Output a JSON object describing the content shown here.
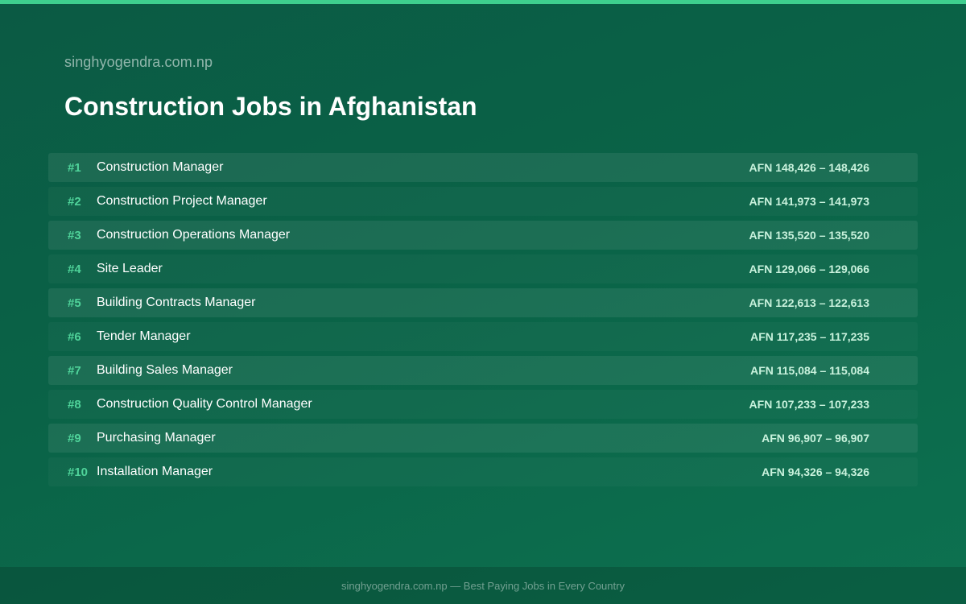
{
  "header": {
    "site_name": "singhyogendra.com.np",
    "title": "Construction Jobs in Afghanistan"
  },
  "jobs": [
    {
      "rank": "#1",
      "title": "Construction Manager",
      "salary": "AFN 148,426 – 148,426"
    },
    {
      "rank": "#2",
      "title": "Construction Project Manager",
      "salary": "AFN 141,973 – 141,973"
    },
    {
      "rank": "#3",
      "title": "Construction Operations Manager",
      "salary": "AFN 135,520 – 135,520"
    },
    {
      "rank": "#4",
      "title": "Site Leader",
      "salary": "AFN 129,066 – 129,066"
    },
    {
      "rank": "#5",
      "title": "Building Contracts Manager",
      "salary": "AFN 122,613 – 122,613"
    },
    {
      "rank": "#6",
      "title": "Tender Manager",
      "salary": "AFN 117,235 – 117,235"
    },
    {
      "rank": "#7",
      "title": "Building Sales Manager",
      "salary": "AFN 115,084 – 115,084"
    },
    {
      "rank": "#8",
      "title": "Construction Quality Control Manager",
      "salary": "AFN 107,233 – 107,233"
    },
    {
      "rank": "#9",
      "title": "Purchasing Manager",
      "salary": "AFN 96,907 – 96,907"
    },
    {
      "rank": "#10",
      "title": "Installation Manager",
      "salary": "AFN 94,326 – 94,326"
    }
  ],
  "footer": {
    "text": "singhyogendra.com.np — Best Paying Jobs in Every Country"
  },
  "colors": {
    "accent": "#3ecf8e",
    "rank": "#4fd39a",
    "background": "#0a6347"
  }
}
